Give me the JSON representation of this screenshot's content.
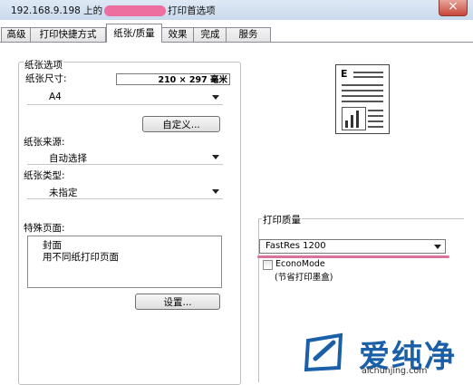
{
  "window": {
    "title_prefix": "192.168.9.198 上的",
    "title_suffix": "打印首选项"
  },
  "tabs": [
    "高级",
    "打印快捷方式",
    "纸张/质量",
    "效果",
    "完成",
    "服务"
  ],
  "paper_options": {
    "group_title": "纸张选项",
    "size_label": "纸张尺寸:",
    "size_dims": "210 × 297 毫米",
    "size_value": "A4",
    "custom_button": "自定义...",
    "source_label": "纸张来源:",
    "source_value": "自动选择",
    "type_label": "纸张类型:",
    "type_value": "未指定"
  },
  "special_pages": {
    "label": "特殊页面:",
    "items": [
      "封面",
      "用不同纸打印页面"
    ],
    "settings_button": "设置..."
  },
  "print_quality": {
    "label": "打印质量",
    "value": "FastRes 1200",
    "econo_label": "EconoMode",
    "econo_desc": "(节省打印墨盒)",
    "econo_checked": false
  },
  "watermark": {
    "text": "爱纯净",
    "url": "aichunjing.com"
  }
}
